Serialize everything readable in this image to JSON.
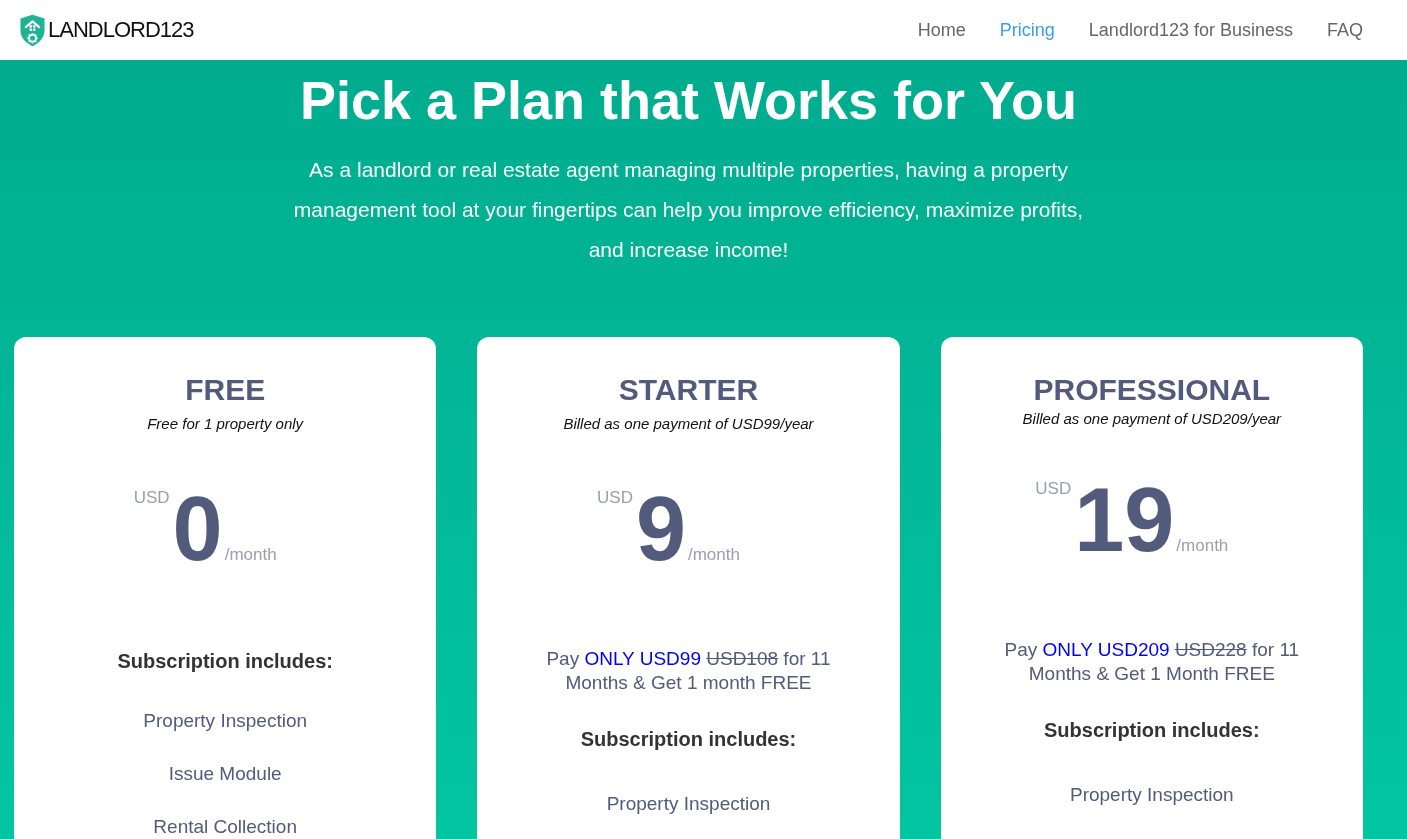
{
  "header": {
    "logo": "LANDLORD123",
    "nav": [
      {
        "label": "Home",
        "selected": false
      },
      {
        "label": "Pricing",
        "selected": true
      },
      {
        "label": "Landlord123 for Business",
        "selected": false
      },
      {
        "label": "FAQ",
        "selected": false
      }
    ]
  },
  "hero": {
    "title": "Pick a Plan that Works for You",
    "description": "As a landlord or real estate agent managing multiple properties, having a property management tool at your fingertips can help you improve efficiency, maximize profits, and increase income!"
  },
  "plans": [
    {
      "name": "FREE",
      "subtitle": "Free for 1 property only",
      "currency": "USD",
      "price": "0",
      "period": "/month",
      "includes_heading": "Subscription includes:",
      "features": [
        "Property Inspection",
        "Issue Module",
        "Rental Collection"
      ]
    },
    {
      "name": "STARTER",
      "subtitle": "Billed as one payment of USD99/year",
      "currency": "USD",
      "price": "9",
      "period": "/month",
      "offer": {
        "prefix": "Pay",
        "highlight": "ONLY USD99",
        "old_price": "USD108",
        "suffix": "for 11 Months & Get 1 month FREE"
      },
      "includes_heading": "Subscription includes:",
      "features": [
        "Property Inspection"
      ]
    },
    {
      "name": "PROFESSIONAL",
      "subtitle": "Billed as one payment of USD209/year",
      "currency": "USD",
      "price": "19",
      "period": "/month",
      "offer": {
        "prefix": "Pay",
        "highlight": "ONLY USD209",
        "old_price": "USD228",
        "suffix": "for 11 Months & Get 1 Month FREE"
      },
      "includes_heading": "Subscription includes:",
      "features": [
        "Property Inspection"
      ]
    }
  ]
}
